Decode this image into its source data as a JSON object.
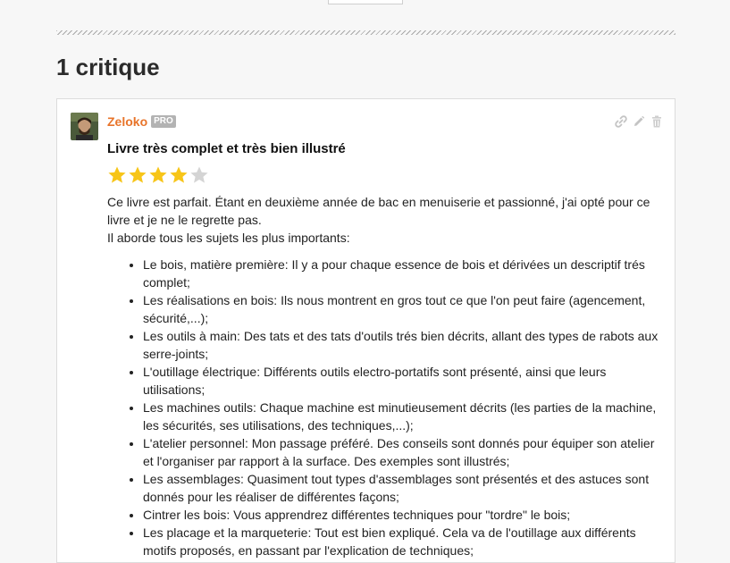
{
  "page": {
    "section_title": "1 critique"
  },
  "review": {
    "author": "Zeloko",
    "badge": "PRO",
    "title": "Livre très complet et très bien illustré",
    "rating": 4,
    "rating_max": 5,
    "intro": [
      "Ce livre est parfait. Étant en deuxième année de bac en menuiserie et passionné, j'ai opté pour ce livre et je ne le regrette pas.",
      "Il aborde tous les sujets les plus importants:"
    ],
    "items": [
      "Le bois, matière première: Il y a pour chaque essence de bois et dérivées un descriptif trés complet;",
      "Les réalisations en bois: Ils nous montrent en gros tout ce que l'on peut faire (agencement, sécurité,...);",
      "Les outils à main: Des tats et des tats d'outils trés bien décrits, allant des types de rabots aux serre-joints;",
      "L'outillage électrique: Différents outils electro-portatifs sont présenté, ainsi que leurs utilisations;",
      "Les machines outils: Chaque machine est minutieusement décrits (les parties de la machine, les sécurités, ses utilisations, des techniques,...);",
      "L'atelier personnel: Mon passage préféré. Des conseils sont donnés pour équiper son atelier et l'organiser par rapport à la surface. Des exemples sont illustrés;",
      "Les assemblages: Quasiment tout types d'assemblages sont présentés et des astuces sont donnés pour les réaliser de différentes façons;",
      "Cintrer les bois: Vous apprendrez différentes techniques pour \"tordre\" le bois;",
      "Les placage et la marqueterie: Tout est bien expliqué. Cela va de l'outillage aux différents motifs proposés, en passant par l'explication de techniques;"
    ]
  },
  "icons": {
    "link": "link-icon",
    "edit": "pencil-icon",
    "delete": "trash-icon"
  },
  "colors": {
    "author": "#e8742a",
    "star_filled": "#f7c518",
    "star_empty": "#d4d4d4",
    "badge_bg": "#b3b3b3"
  }
}
